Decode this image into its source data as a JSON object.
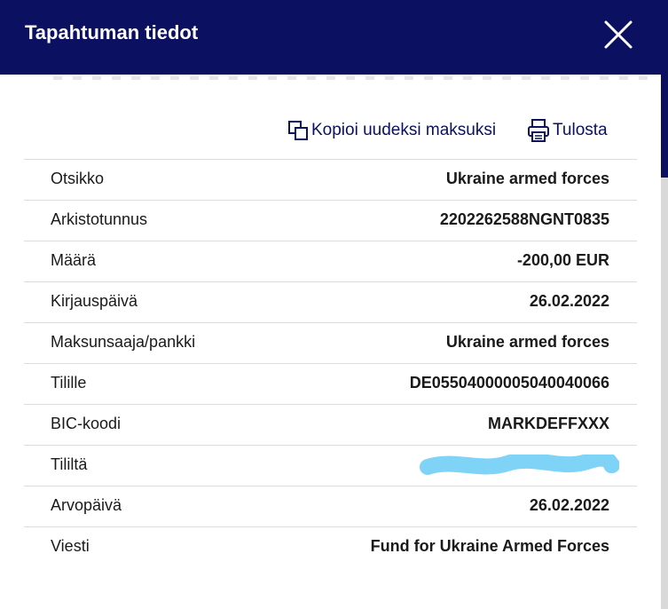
{
  "modal": {
    "title": "Tapahtuman tiedot",
    "close_icon": "close-icon"
  },
  "actions": {
    "copy_label": "Kopioi uudeksi maksuksi",
    "copy_icon": "copy-icon",
    "print_label": "Tulosta",
    "print_icon": "printer-icon"
  },
  "details": [
    {
      "label": "Otsikko",
      "value": "Ukraine armed forces"
    },
    {
      "label": "Arkistotunnus",
      "value": "2202262588NGNT0835"
    },
    {
      "label": "Määrä",
      "value": "-200,00 EUR"
    },
    {
      "label": "Kirjauspäivä",
      "value": "26.02.2022"
    },
    {
      "label": "Maksunsaaja/pankki",
      "value": "Ukraine armed forces"
    },
    {
      "label": "Tilille",
      "value": "DE05504000005040040066"
    },
    {
      "label": "BIC-koodi",
      "value": "MARKDEFFXXX"
    },
    {
      "label": "Tililtä",
      "value": null,
      "redacted": true
    },
    {
      "label": "Arvopäivä",
      "value": "26.02.2022"
    },
    {
      "label": "Viesti",
      "value": "Fund for Ukraine Armed Forces"
    }
  ],
  "colors": {
    "header_bg": "#0b1060",
    "accent": "#0b1060",
    "redaction": "#7fd3f7"
  }
}
